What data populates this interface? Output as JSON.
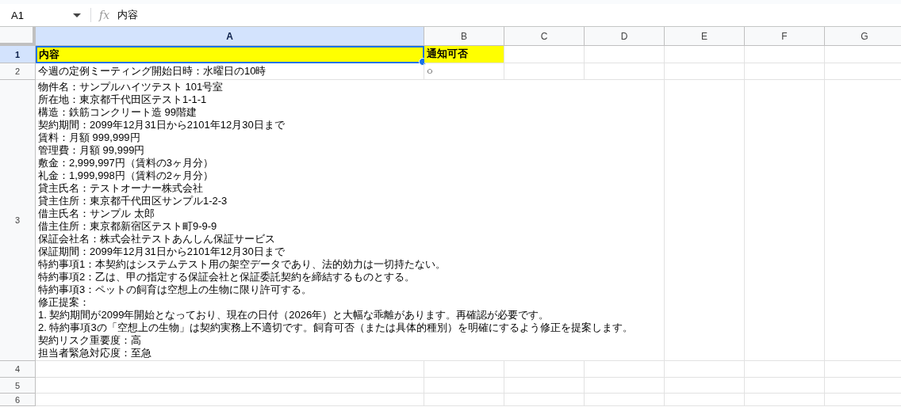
{
  "formula_bar": {
    "name_box": "A1",
    "fx_label": "fx",
    "formula": "内容"
  },
  "columns": [
    {
      "label": "A",
      "selected": true
    },
    {
      "label": "B",
      "selected": false
    },
    {
      "label": "C",
      "selected": false
    },
    {
      "label": "D",
      "selected": false
    },
    {
      "label": "E",
      "selected": false
    },
    {
      "label": "F",
      "selected": false
    },
    {
      "label": "G",
      "selected": false
    }
  ],
  "rows": [
    {
      "number": "1",
      "selected": true,
      "kind": "header",
      "cells": [
        "内容",
        "通知可否"
      ]
    },
    {
      "number": "2",
      "selected": false,
      "kind": "plain",
      "cells": [
        "今週の定例ミーティング開始日時：水曜日の10時",
        "○"
      ]
    },
    {
      "number": "3",
      "selected": false,
      "kind": "merged",
      "lines": [
        "物件名：サンプルハイツテスト 101号室",
        "所在地：東京都千代田区テスト1-1-1",
        "構造：鉄筋コンクリート造 99階建",
        "契約期間：2099年12月31日から2101年12月30日まで",
        "賃料：月額 999,999円",
        "管理費：月額 99,999円",
        "敷金：2,999,997円（賃料の3ヶ月分）",
        "礼金：1,999,998円（賃料の2ヶ月分）",
        "貸主氏名：テストオーナー株式会社",
        "貸主住所：東京都千代田区サンプル1-2-3",
        "借主氏名：サンプル 太郎",
        "借主住所：東京都新宿区テスト町9-9-9",
        "保証会社名：株式会社テストあんしん保証サービス",
        "保証期間：2099年12月31日から2101年12月30日まで",
        "特約事項1：本契約はシステムテスト用の架空データであり、法的効力は一切持たない。",
        "特約事項2：乙は、甲の指定する保証会社と保証委託契約を締結するものとする。",
        "特約事項3：ペットの飼育は空想上の生物に限り許可する。",
        "修正提案：",
        "1. 契約期間が2099年開始となっており、現在の日付（2026年）と大幅な乖離があります。再確認が必要です。",
        "2. 特約事項3の「空想上の生物」は契約実務上不適切です。飼育可否（または具体的種別）を明確にするよう修正を提案します。",
        "契約リスク重要度：高",
        "担当者緊急対応度：至急"
      ]
    },
    {
      "number": "4",
      "selected": false,
      "kind": "plain",
      "cells": []
    },
    {
      "number": "5",
      "selected": false,
      "kind": "plain",
      "cells": []
    },
    {
      "number": "6",
      "selected": false,
      "kind": "plain",
      "cells": []
    }
  ]
}
